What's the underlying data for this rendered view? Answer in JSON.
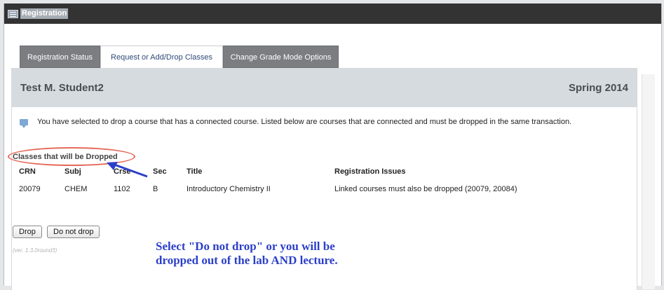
{
  "window": {
    "title": "Registration"
  },
  "tabs": [
    {
      "label": "Registration Status",
      "active": false
    },
    {
      "label": "Request or Add/Drop Classes",
      "active": true
    },
    {
      "label": "Change Grade Mode Options",
      "active": false
    }
  ],
  "student": {
    "name": "Test M. Student2",
    "term": "Spring 2014"
  },
  "notice": {
    "icon": "speech-bubble-icon",
    "text": "You have selected to drop a course that has a connected course. Listed below are courses that are connected and must be dropped in the same transaction."
  },
  "section": {
    "title": "Classes that will be Dropped"
  },
  "table": {
    "headers": {
      "crn": "CRN",
      "subj": "Subj",
      "crse": "Crse",
      "sec": "Sec",
      "title": "Title",
      "issues": "Registration Issues"
    },
    "rows": [
      {
        "crn": "20079",
        "subj": "CHEM",
        "crse": "1102",
        "sec": "B",
        "title": "Introductory Chemistry II",
        "issues": "Linked courses must also be dropped (20079, 20084)"
      }
    ]
  },
  "buttons": {
    "drop": "Drop",
    "do_not_drop": "Do not drop"
  },
  "version": "(ver. 1.3.0round3)",
  "annotation": {
    "line1": "Select \"Do not drop\" or you will be",
    "line2": "dropped out of the lab AND lecture."
  },
  "colors": {
    "titlebar": "#333333",
    "tab_inactive": "#7b7d81",
    "tab_active_text": "#2e4a78",
    "header_band": "#d6dbdf",
    "highlight_oval": "#e46a5a",
    "annotation": "#2b3fc9"
  }
}
